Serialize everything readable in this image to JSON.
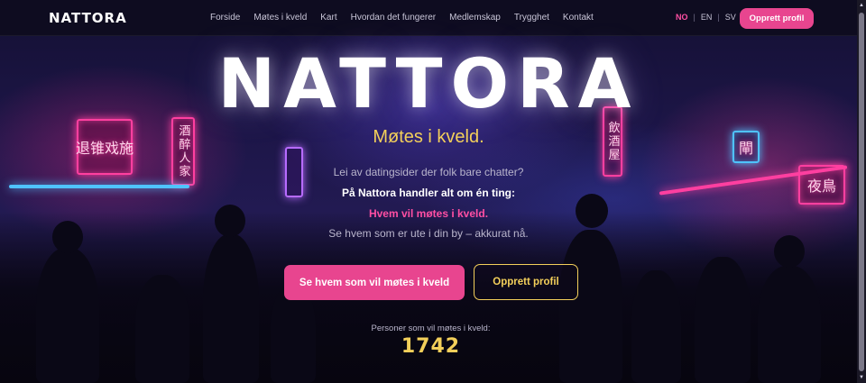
{
  "nav": {
    "logo": "NATTORA",
    "links": [
      "Forside",
      "Møtes i kveld",
      "Kart",
      "Hvordan det fungerer",
      "Medlemskap",
      "Trygghet",
      "Kontakt"
    ],
    "languages": [
      "NO",
      "EN",
      "SV"
    ],
    "active_language": "NO",
    "cta_label": "Opprett profil"
  },
  "hero": {
    "title": "NATTORA",
    "subtitle": "Møtes i kveld.",
    "line1": "Lei av datingsider der folk bare chatter?",
    "line2": "På Nattora handler alt om én ting:",
    "line3": "Hvem vil møtes i kveld.",
    "line4": "Se hvem som er ute i din by – akkurat nå.",
    "primary_button": "Se hvem som vil møtes i kveld",
    "secondary_button": "Opprett profil",
    "counter_label": "Personer som vil møtes i kveld:",
    "counter_value": "1742"
  },
  "signs": {
    "left": "退锥戏施",
    "left_vertical": "酒醉人家",
    "right_vertical": "飲酒屋",
    "right": "夜鳥",
    "right_small": "閘"
  },
  "colors": {
    "accent_pink": "#e8458f",
    "accent_yellow": "#f3cf5a",
    "background": "#0e0b1e"
  },
  "icons": {
    "scroll_up": "triangle-up-icon",
    "scroll_down": "triangle-down-icon"
  }
}
